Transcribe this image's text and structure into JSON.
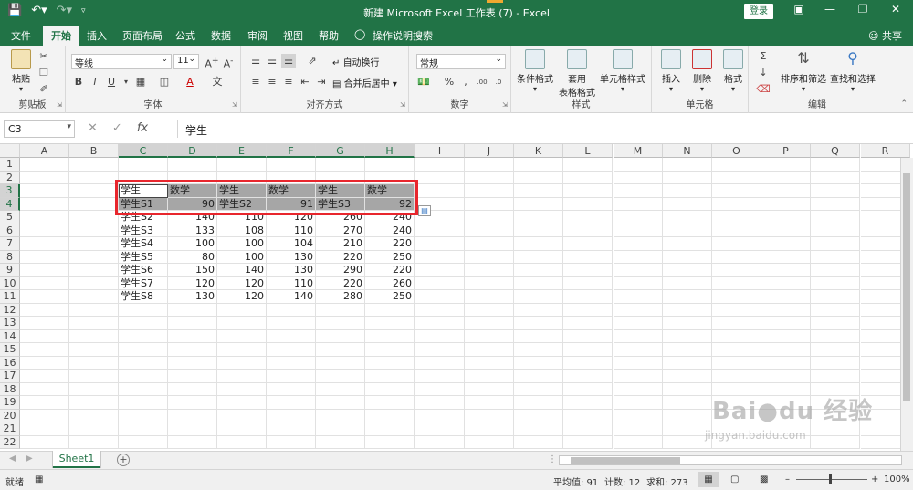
{
  "titlebar": {
    "title": "新建 Microsoft Excel 工作表 (7)  -  Excel",
    "login": "登录",
    "qat_icons": [
      "save-icon",
      "undo-icon",
      "redo-icon",
      "customize-icon"
    ]
  },
  "tabs": [
    "文件",
    "开始",
    "插入",
    "页面布局",
    "公式",
    "数据",
    "审阅",
    "视图",
    "帮助",
    "操作说明搜索"
  ],
  "share": "共享",
  "ribbon": {
    "clipboard": {
      "label": "剪贴板",
      "paste": "粘贴"
    },
    "font": {
      "label": "字体",
      "name": "等线",
      "size": "11",
      "bold": "B",
      "italic": "I",
      "underline": "U"
    },
    "alignment": {
      "label": "对齐方式",
      "wrap": "自动换行",
      "merge": "合并后居中"
    },
    "number": {
      "label": "数字",
      "format": "常规"
    },
    "styles": {
      "label": "样式",
      "cond": "条件格式",
      "table1": "套用",
      "table2": "表格格式",
      "cell": "单元格样式"
    },
    "cells": {
      "label": "单元格",
      "insert": "插入",
      "delete": "删除",
      "format": "格式"
    },
    "editing": {
      "label": "编辑",
      "sort": "排序和筛选",
      "find": "查找和选择"
    }
  },
  "formula_bar": {
    "name_box": "C3",
    "formula": "学生"
  },
  "columns": [
    "A",
    "B",
    "C",
    "D",
    "E",
    "F",
    "G",
    "H",
    "I",
    "J",
    "K",
    "L",
    "M",
    "N",
    "O",
    "P",
    "Q",
    "R"
  ],
  "rows": [
    "1",
    "2",
    "3",
    "4",
    "5",
    "6",
    "7",
    "8",
    "9",
    "10",
    "11",
    "12",
    "13",
    "14",
    "15",
    "16",
    "17",
    "18",
    "19",
    "20",
    "21",
    "22"
  ],
  "cells": {
    "r3": [
      "学生",
      "数学",
      "学生",
      "数学",
      "学生",
      "数学"
    ],
    "r4": [
      "学生S1",
      "90",
      "学生S2",
      "91",
      "学生S3",
      "92"
    ],
    "data": [
      [
        "学生S2",
        "140",
        "110",
        "120",
        "260",
        "240"
      ],
      [
        "学生S3",
        "133",
        "108",
        "110",
        "270",
        "240"
      ],
      [
        "学生S4",
        "100",
        "100",
        "104",
        "210",
        "220"
      ],
      [
        "学生S5",
        "80",
        "100",
        "130",
        "220",
        "250"
      ],
      [
        "学生S6",
        "150",
        "140",
        "130",
        "290",
        "220"
      ],
      [
        "学生S7",
        "120",
        "120",
        "110",
        "220",
        "260"
      ],
      [
        "学生S8",
        "130",
        "120",
        "140",
        "280",
        "250"
      ]
    ]
  },
  "sheet_tab": "Sheet1",
  "status": {
    "ready": "就绪",
    "average": "平均值: 91",
    "count": "计数: 12",
    "sum": "求和: 273",
    "zoom": "100%",
    "zoom_level": 1.0
  },
  "watermark": {
    "text": "Bai du 经验",
    "url": "jingyan.baidu.com"
  }
}
